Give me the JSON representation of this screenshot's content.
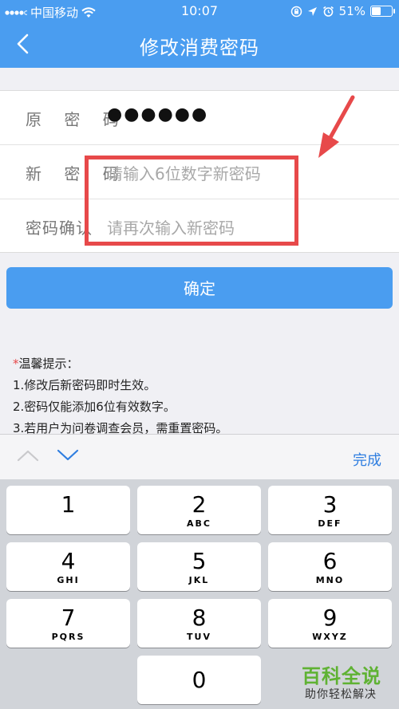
{
  "status_bar": {
    "carrier": "中国移动",
    "time": "10:07",
    "battery": "51%",
    "battery_level": 0.51
  },
  "nav": {
    "title": "修改消费密码",
    "back_icon": "chevron-left-icon"
  },
  "form": {
    "old_password": {
      "label": "原 密 码",
      "value": "●●●●●●"
    },
    "new_password": {
      "label": "新 密 码",
      "placeholder": "请输入6位数字新密码"
    },
    "confirm_password": {
      "label": "密码确认",
      "placeholder": "请再次输入新密码"
    }
  },
  "confirm_button": "确定",
  "tips": {
    "star": "*",
    "title": "温馨提示：",
    "items": [
      "1.修改后新密码即时生效。",
      "2.密码仅能添加6位有效数字。",
      "3.若用户为问卷调查会员，需重置密码。"
    ]
  },
  "accessory": {
    "done": "完成"
  },
  "keypad": [
    {
      "num": "1",
      "letters": ""
    },
    {
      "num": "2",
      "letters": "ABC"
    },
    {
      "num": "3",
      "letters": "DEF"
    },
    {
      "num": "4",
      "letters": "GHI"
    },
    {
      "num": "5",
      "letters": "JKL"
    },
    {
      "num": "6",
      "letters": "MNO"
    },
    {
      "num": "7",
      "letters": "PQRS"
    },
    {
      "num": "8",
      "letters": "TUV"
    },
    {
      "num": "9",
      "letters": "WXYZ"
    },
    {
      "num": "0",
      "letters": ""
    }
  ],
  "watermark": {
    "title": "百科全说",
    "subtitle": "助你轻松解决"
  },
  "colors": {
    "brand_blue": "#4a9df0",
    "highlight_red": "#e7494a",
    "link_blue": "#2f7ee0",
    "watermark_green": "#5fb233"
  }
}
